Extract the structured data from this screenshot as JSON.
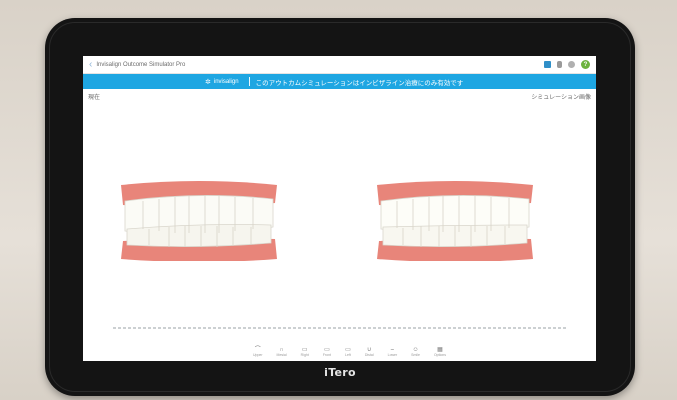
{
  "device": {
    "brand": "iTero"
  },
  "app": {
    "title": "Invisalign Outcome Simulator Pro",
    "toolbar_icons": [
      "camera-icon",
      "trash-icon",
      "gear-icon",
      "help-icon"
    ],
    "help_label": "?"
  },
  "banner": {
    "logo": "invisalign",
    "message": "このアウトカムシミュレーションはインビザライン治療にのみ有効です"
  },
  "panels": {
    "left_label": "現在",
    "right_label": "シミュレーション画像"
  },
  "toolbar": {
    "tools": [
      {
        "icon": "upper-jaw-icon",
        "glyph": "⌒",
        "label": "Upper"
      },
      {
        "icon": "mesial-icon",
        "glyph": "∩",
        "label": "Mesial"
      },
      {
        "icon": "right-icon",
        "glyph": "▭",
        "label": "Right"
      },
      {
        "icon": "front-icon",
        "glyph": "▭",
        "label": "Front"
      },
      {
        "icon": "left-icon",
        "glyph": "▭",
        "label": "Left"
      },
      {
        "icon": "distal-icon",
        "glyph": "∪",
        "label": "Distal"
      },
      {
        "icon": "lower-jaw-icon",
        "glyph": "⌣",
        "label": "Lower"
      },
      {
        "icon": "smile-icon",
        "glyph": "☺",
        "label": "Smile"
      },
      {
        "icon": "options-icon",
        "glyph": "▦",
        "label": "Options"
      }
    ]
  },
  "colors": {
    "banner": "#1ea6e2",
    "gum": "#e8857a",
    "tooth": "#fbfbf6",
    "help": "#6db33f"
  }
}
